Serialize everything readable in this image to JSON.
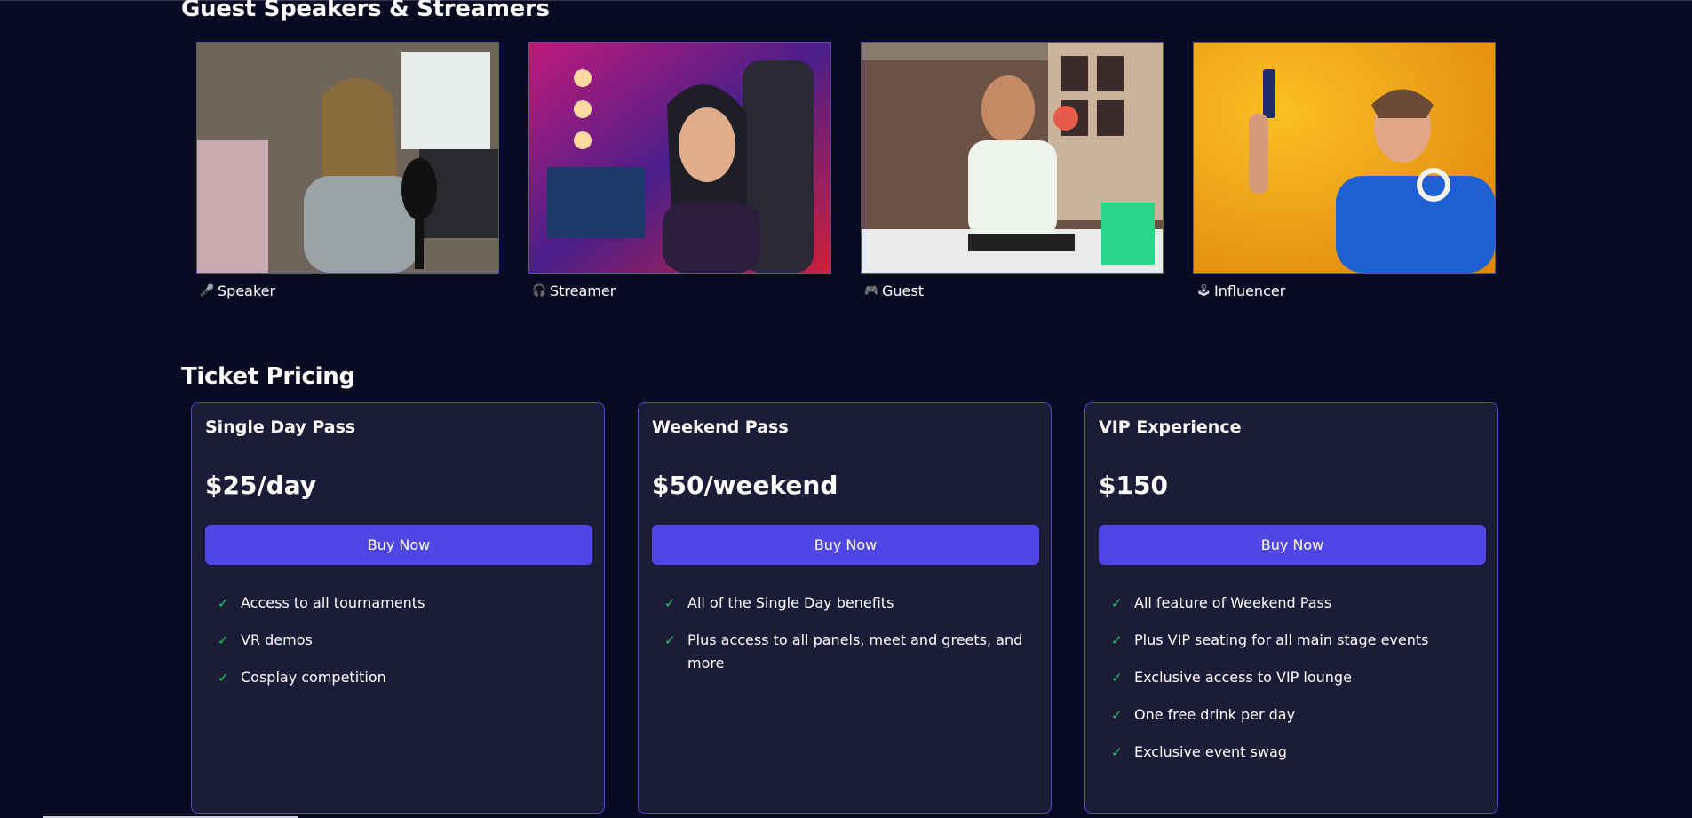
{
  "speakers": {
    "title": "Guest Speakers & Streamers",
    "items": [
      {
        "icon": "microphone-icon",
        "glyph": "🎤",
        "label": "Speaker"
      },
      {
        "icon": "headphones-icon",
        "glyph": "🎧",
        "label": "Streamer"
      },
      {
        "icon": "gamepad-icon",
        "glyph": "🎮",
        "label": "Guest"
      },
      {
        "icon": "joystick-icon",
        "glyph": "🕹",
        "label": "Influencer"
      }
    ]
  },
  "pricing": {
    "title": "Ticket Pricing",
    "cards": [
      {
        "name": "Single Day Pass",
        "price": "$25/day",
        "button": "Buy Now",
        "features": [
          "Access to all tournaments",
          "VR demos",
          "Cosplay competition"
        ]
      },
      {
        "name": "Weekend Pass",
        "price": "$50/weekend",
        "button": "Buy Now",
        "features": [
          "All of the Single Day benefits",
          "Plus access to all panels, meet and greets, and more"
        ]
      },
      {
        "name": "VIP Experience",
        "price": "$150",
        "button": "Buy Now",
        "features": [
          "All feature of Weekend Pass",
          "Plus VIP seating for all main stage events",
          "Exclusive access to VIP lounge",
          "One free drink per day",
          "Exclusive event swag"
        ]
      }
    ]
  },
  "colors": {
    "background": "#0a0a23",
    "card": "#1c1b38",
    "accent": "#4f46e5",
    "check": "#22c55e"
  }
}
